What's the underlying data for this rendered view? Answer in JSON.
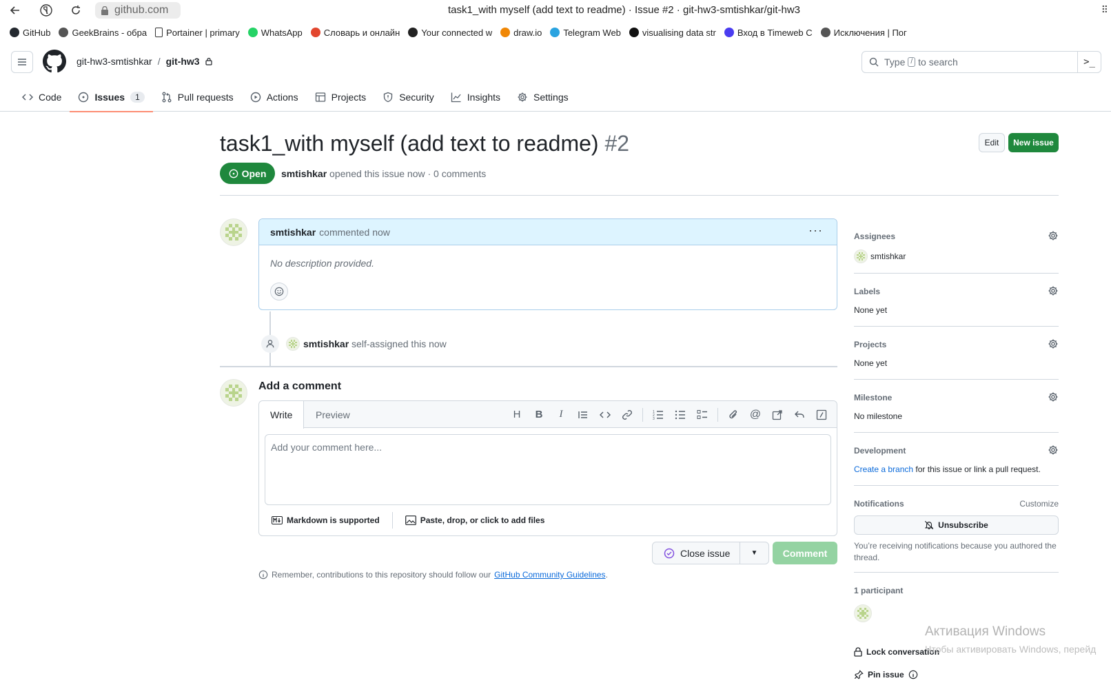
{
  "browser": {
    "url": "github.com",
    "title": "task1_with myself (add text to readme) · Issue #2 · git-hw3-smtishkar/git-hw3",
    "bookmarks": [
      {
        "label": "GitHub",
        "icon": "github-icon",
        "color": "#24292f"
      },
      {
        "label": "GeekBrains - обра",
        "icon": "geekbrains-icon",
        "color": "#555555"
      },
      {
        "label": "Portainer | primary",
        "icon": "page-icon",
        "color": "#ffffff"
      },
      {
        "label": "WhatsApp",
        "icon": "whatsapp-icon",
        "color": "#25d366"
      },
      {
        "label": "Словарь и онлайн",
        "icon": "dictionary-icon",
        "color": "#e2462e"
      },
      {
        "label": "Your connected w",
        "icon": "notion-icon",
        "color": "#222222"
      },
      {
        "label": "draw.io",
        "icon": "drawio-icon",
        "color": "#f08705"
      },
      {
        "label": "Telegram Web",
        "icon": "telegram-icon",
        "color": "#2aa3e0"
      },
      {
        "label": "visualising data str",
        "icon": "va-icon",
        "color": "#111111"
      },
      {
        "label": "Вход в Timeweb C",
        "icon": "timeweb-icon",
        "color": "#4a3cf0"
      },
      {
        "label": "Исключения | Пог",
        "icon": "globe-icon",
        "color": "#555555"
      }
    ]
  },
  "header": {
    "owner": "git-hw3-smtishkar",
    "separator": "/",
    "repo": "git-hw3",
    "search_placeholder_1": "Type",
    "search_kbd": "/",
    "search_placeholder_2": "to search"
  },
  "repo_tabs": [
    {
      "label": "Code",
      "icon": "code-icon"
    },
    {
      "label": "Issues",
      "icon": "issue-opened-icon",
      "count": "1",
      "active": true
    },
    {
      "label": "Pull requests",
      "icon": "git-pull-request-icon"
    },
    {
      "label": "Actions",
      "icon": "play-icon"
    },
    {
      "label": "Projects",
      "icon": "table-icon"
    },
    {
      "label": "Security",
      "icon": "shield-icon"
    },
    {
      "label": "Insights",
      "icon": "graph-icon"
    },
    {
      "label": "Settings",
      "icon": "gear-icon"
    }
  ],
  "issue": {
    "title": "task1_with myself (add text to readme)",
    "number": "#2",
    "state": "Open",
    "author": "smtishkar",
    "meta_rest": "opened this issue now · 0 comments",
    "edit_label": "Edit",
    "new_issue_label": "New issue"
  },
  "comment": {
    "author": "smtishkar",
    "action": "commented now",
    "body": "No description provided."
  },
  "event": {
    "actor": "smtishkar",
    "text": "self-assigned this now"
  },
  "composer": {
    "title": "Add a comment",
    "tab_write": "Write",
    "tab_preview": "Preview",
    "placeholder": "Add your comment here...",
    "markdown_note": "Markdown is supported",
    "files_note": "Paste, drop, or click to add files",
    "close_issue_label": "Close issue",
    "comment_label": "Comment",
    "guidelines_prefix": "Remember, contributions to this repository should follow our",
    "guidelines_link": "GitHub Community Guidelines",
    "guidelines_suffix": "."
  },
  "sidebar": {
    "assignees_title": "Assignees",
    "assignee": "smtishkar",
    "labels_title": "Labels",
    "labels_value": "None yet",
    "projects_title": "Projects",
    "projects_value": "None yet",
    "milestone_title": "Milestone",
    "milestone_value": "No milestone",
    "development_title": "Development",
    "development_link": "Create a branch",
    "development_rest": "for this issue or link a pull request.",
    "notifications_title": "Notifications",
    "customize_label": "Customize",
    "unsubscribe_label": "Unsubscribe",
    "notifications_note": "You’re receiving notifications because you authored the thread.",
    "participants_title": "1 participant",
    "lock_label": "Lock conversation",
    "pin_label": "Pin issue"
  },
  "os_watermark": {
    "line1": "Активация Windows",
    "line2": "Чтобы активировать Windows, перейд"
  },
  "colors": {
    "accent_green": "#1f883d",
    "link_blue": "#0969da",
    "tab_underline": "#fd8c73",
    "comment_header": "#ddf4ff"
  }
}
